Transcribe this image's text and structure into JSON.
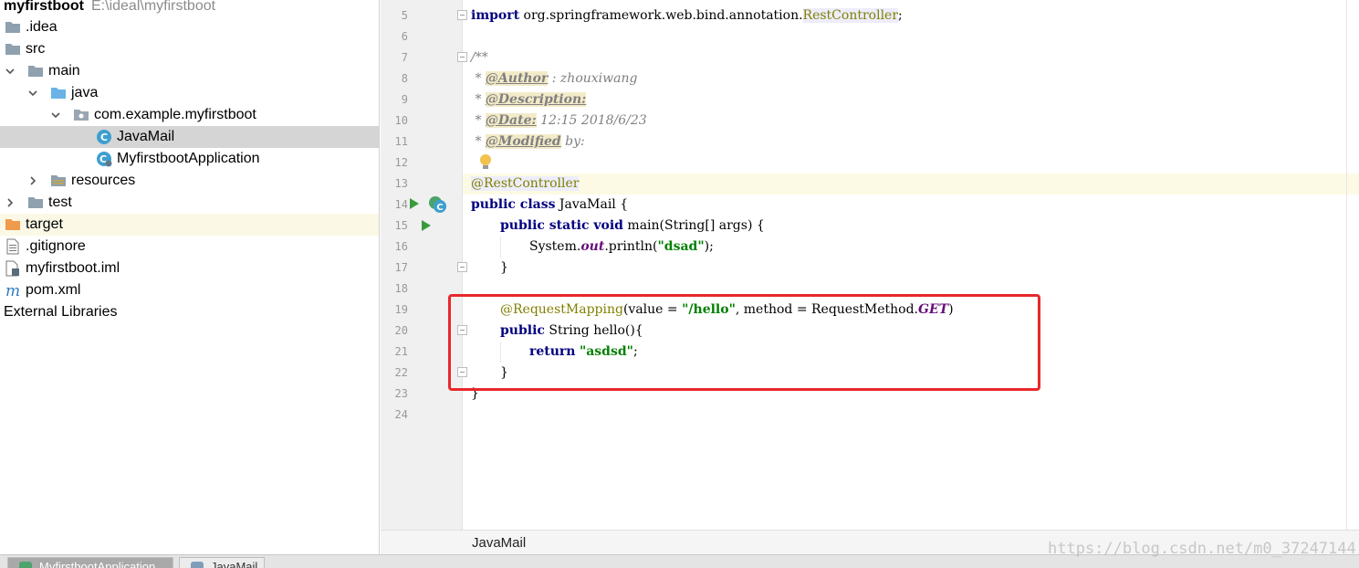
{
  "project_tree": {
    "root": {
      "name": "myfirstboot",
      "path": "E:\\ideal\\myfirstboot"
    },
    "items": [
      {
        "label": ".idea",
        "icon": "folder-icon"
      },
      {
        "label": "src",
        "icon": "folder-icon"
      },
      {
        "label": "main",
        "icon": "folder-icon",
        "expanded": true
      },
      {
        "label": "java",
        "icon": "source-folder-icon",
        "expanded": true
      },
      {
        "label": "com.example.myfirstboot",
        "icon": "package-icon",
        "expanded": true
      },
      {
        "label": "JavaMail",
        "icon": "java-class-icon",
        "selected": true
      },
      {
        "label": "MyfirstbootApplication",
        "icon": "spring-boot-class-icon"
      },
      {
        "label": "resources",
        "icon": "resources-folder-icon",
        "expanded": false
      },
      {
        "label": "test",
        "icon": "folder-icon",
        "expanded": false
      },
      {
        "label": "target",
        "icon": "excluded-folder-icon"
      },
      {
        "label": ".gitignore",
        "icon": "text-file-icon"
      },
      {
        "label": "myfirstboot.iml",
        "icon": "module-file-icon"
      },
      {
        "label": "pom.xml",
        "icon": "maven-icon"
      },
      {
        "label": "External Libraries",
        "icon": ""
      }
    ]
  },
  "editor": {
    "line_numbers": [
      "5",
      "6",
      "7",
      "8",
      "9",
      "10",
      "11",
      "12",
      "13",
      "14",
      "15",
      "16",
      "17",
      "18",
      "19",
      "20",
      "21",
      "22",
      "23",
      "24"
    ],
    "code": {
      "l5_kw": "import",
      "l5_pkg": " org.springframework.web.bind.annotation.",
      "l5_cls": "RestController",
      "l5_end": ";",
      "l7": "/**",
      "l8_star": " * ",
      "l8_tag": "@Author",
      "l8_rest": " : zhouxiwang",
      "l9_star": " * ",
      "l9_tag": "@Description:",
      "l10_star": " * ",
      "l10_tag": "@Date:",
      "l10_rest": " 12:15 2018/6/23",
      "l11_star": " * ",
      "l11_tag": "@Modified",
      "l11_rest": " by:",
      "l13": "@RestController",
      "l14_kw": "public class",
      "l14_rest": " JavaMail {",
      "l15_kw": "public static void",
      "l15_rest": " main(String[] args) {",
      "l16_a": "System.",
      "l16_field": "out",
      "l16_b": ".println(",
      "l16_str": "\"dsad\"",
      "l16_c": ");",
      "l17": "}",
      "l19_ann": "@RequestMapping",
      "l19_a": "(value = ",
      "l19_str": "\"/hello\"",
      "l19_b": ", method = RequestMethod.",
      "l19_field": "GET",
      "l19_c": ")",
      "l20_kw": "public",
      "l20_rest": " String hello(){",
      "l21_kw": "return",
      "l21_str": "\"asdsd\"",
      "l21_end": ";",
      "l22": "}",
      "l23": "}"
    },
    "breadcrumb": "JavaMail",
    "colors": {
      "highlight_box": "#e8282b",
      "keyword": "#000080",
      "string": "#008000",
      "annotation": "#808000"
    }
  },
  "bottom_tabs": [
    {
      "label": "MyfirstbootApplication",
      "active": true
    },
    {
      "label": "JavaMail",
      "active": false
    }
  ],
  "watermark": "https://blog.csdn.net/m0_37247144"
}
